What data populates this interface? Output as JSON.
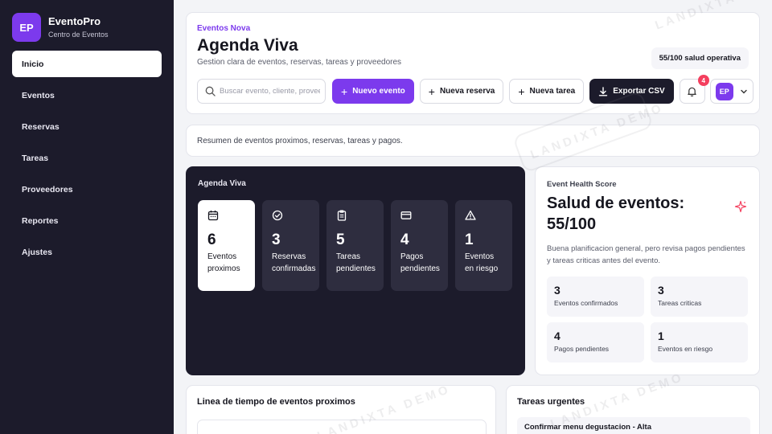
{
  "brand": {
    "logo": "EP",
    "name": "EventoPro",
    "subtitle": "Centro de Eventos"
  },
  "nav": [
    {
      "label": "Inicio",
      "active": true
    },
    {
      "label": "Eventos"
    },
    {
      "label": "Reservas"
    },
    {
      "label": "Tareas"
    },
    {
      "label": "Proveedores"
    },
    {
      "label": "Reportes"
    },
    {
      "label": "Ajustes"
    }
  ],
  "header": {
    "kicker": "Eventos Nova",
    "title": "Agenda Viva",
    "subtitle": "Gestion clara de eventos, reservas, tareas y proveedores",
    "health_pill": "55/100 salud operativa"
  },
  "toolbar": {
    "search_placeholder": "Buscar evento, cliente, proveedor",
    "search_value": "",
    "new_event": "Nuevo evento",
    "new_booking": "Nueva reserva",
    "new_task": "Nueva tarea",
    "export": "Exportar CSV",
    "notifications_count": "4",
    "user_initials": "EP"
  },
  "summary": "Resumen de eventos proximos, reservas, tareas y pagos.",
  "agenda": {
    "title": "Agenda Viva",
    "stats": [
      {
        "value": "6",
        "label": "Eventos proximos",
        "icon": "calendar-icon",
        "active": true
      },
      {
        "value": "3",
        "label": "Reservas confirmadas",
        "icon": "check-circle-icon"
      },
      {
        "value": "5",
        "label": "Tareas pendientes",
        "icon": "clipboard-icon"
      },
      {
        "value": "4",
        "label": "Pagos pendientes",
        "icon": "card-icon"
      },
      {
        "value": "1",
        "label": "Eventos en riesgo",
        "icon": "warning-icon"
      }
    ]
  },
  "health": {
    "kicker": "Event Health Score",
    "title": "Salud de eventos: 55/100",
    "description": "Buena planificacion general, pero revisa pagos pendientes y tareas criticas antes del evento.",
    "metrics": [
      {
        "value": "3",
        "label": "Eventos confirmados"
      },
      {
        "value": "3",
        "label": "Tareas criticas"
      },
      {
        "value": "4",
        "label": "Pagos pendientes"
      },
      {
        "value": "1",
        "label": "Eventos en riesgo"
      }
    ]
  },
  "timeline": {
    "title": "Linea de tiempo de eventos proximos"
  },
  "tasks": {
    "title": "Tareas urgentes",
    "first_item": "Confirmar menu degustacion - Alta"
  },
  "watermark": "LANDIXTA DEMO",
  "colors": {
    "accent": "#7c3aed",
    "sidebar": "#1c1b2b",
    "badge": "#f43f5e"
  }
}
